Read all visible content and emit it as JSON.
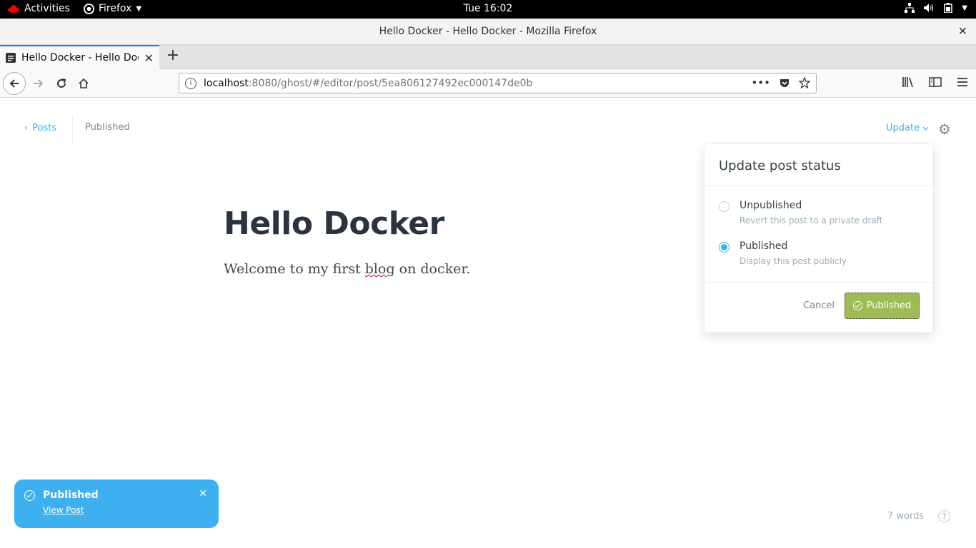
{
  "system": {
    "activities": "Activities",
    "app_name": "Firefox",
    "clock": "Tue 16:02"
  },
  "window": {
    "title": "Hello Docker - Hello Docker - Mozilla Firefox"
  },
  "browser": {
    "tab_title": "Hello Docker - Hello Docker",
    "url_host": "localhost",
    "url_path": ":8080/ghost/#/editor/post/5ea806127492ec000147de0b"
  },
  "editor": {
    "back_label": "Posts",
    "status": "Published",
    "update_label": "Update",
    "post_title": "Hello Docker",
    "body_before": "Welcome to my first ",
    "body_misspelled": "blog",
    "body_after": " on docker.",
    "word_count": "7 words",
    "help": "?"
  },
  "popover": {
    "heading": "Update post status",
    "options": [
      {
        "label": "Unpublished",
        "description": "Revert this post to a private draft",
        "selected": false
      },
      {
        "label": "Published",
        "description": "Display this post publicly",
        "selected": true
      }
    ],
    "cancel_label": "Cancel",
    "confirm_label": "Published"
  },
  "notification": {
    "title": "Published",
    "link": "View Post"
  },
  "colors": {
    "accent_blue": "#3eb0ef",
    "publish_green": "#9fbb58",
    "firefox_tab_accent": "#0a84ff"
  }
}
